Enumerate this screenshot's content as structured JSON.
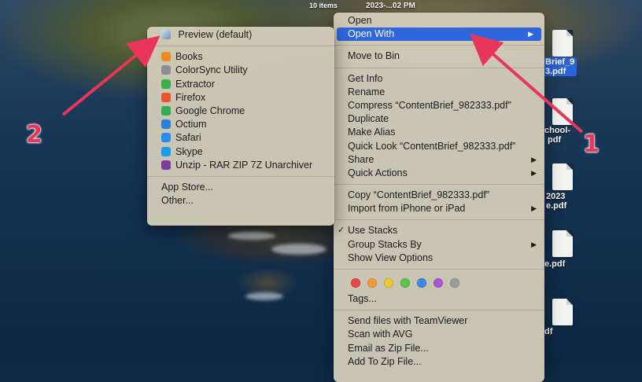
{
  "desktop": {
    "status_text": "10 items",
    "date_text": "2023-...02 PM",
    "files": [
      {
        "line1": "Brief_9",
        "line2": "3.pdf",
        "selected": true
      },
      {
        "line1": "chool-",
        "line2": "pdf",
        "selected": false
      },
      {
        "line1": "2023",
        "line2": "e.pdf",
        "selected": false
      },
      {
        "line1": "e.pdf",
        "line2": "",
        "selected": false
      },
      {
        "line1": "df",
        "line2": "",
        "selected": false
      }
    ]
  },
  "context_menu": {
    "items": {
      "open": "Open",
      "open_with": "Open With",
      "move_to_bin": "Move to Bin",
      "get_info": "Get Info",
      "rename": "Rename",
      "compress": "Compress “ContentBrief_982333.pdf”",
      "duplicate": "Duplicate",
      "make_alias": "Make Alias",
      "quick_look": "Quick Look “ContentBrief_982333.pdf”",
      "share": "Share",
      "quick_actions": "Quick Actions",
      "copy": "Copy “ContentBrief_982333.pdf”",
      "import_iphone": "Import from iPhone or iPad",
      "use_stacks": "Use Stacks",
      "group_stacks_by": "Group Stacks By",
      "show_view_options": "Show View Options",
      "tags": "Tags...",
      "send_teamviewer": "Send files with TeamViewer",
      "scan_avg": "Scan with AVG",
      "email_zip": "Email as Zip File...",
      "add_to_zip": "Add To Zip File..."
    },
    "tag_colors": [
      "#e94646",
      "#f29a33",
      "#f2c531",
      "#5cc24a",
      "#3f86e8",
      "#a855d4",
      "#9b9b9b"
    ],
    "highlight_color": "#2e67dd"
  },
  "open_with_submenu": {
    "default_app": "Preview (default)",
    "apps": [
      {
        "name": "Books",
        "icon": "books-icon",
        "color": "#f08a24"
      },
      {
        "name": "ColorSync Utility",
        "icon": "colorsync-icon",
        "color": "#8a8f96"
      },
      {
        "name": "Extractor",
        "icon": "extractor-icon",
        "color": "#3bb04a"
      },
      {
        "name": "Firefox",
        "icon": "firefox-icon",
        "color": "#e8552c"
      },
      {
        "name": "Google Chrome",
        "icon": "chrome-icon",
        "color": "#34a853"
      },
      {
        "name": "Octium",
        "icon": "octium-icon",
        "color": "#2f7fd6"
      },
      {
        "name": "Safari",
        "icon": "safari-icon",
        "color": "#2b8cf0"
      },
      {
        "name": "Skype",
        "icon": "skype-icon",
        "color": "#1d9bf0"
      },
      {
        "name": "Unzip - RAR ZIP 7Z Unarchiver",
        "icon": "unarchiver-icon",
        "color": "#7a3f9e"
      }
    ],
    "app_store": "App Store...",
    "other": "Other..."
  },
  "annotations": {
    "callout_1": "1",
    "callout_2": "2",
    "arrow_color": "#e8355a"
  }
}
